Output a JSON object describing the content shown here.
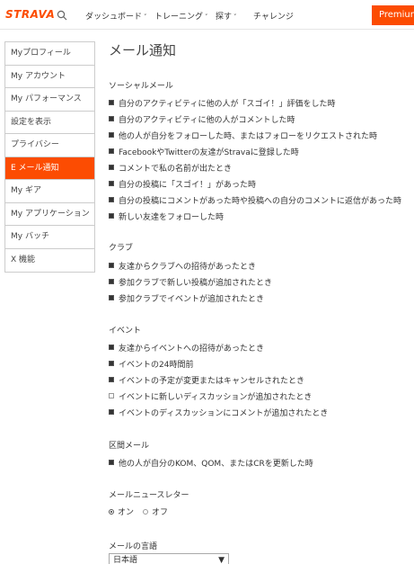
{
  "header": {
    "logo": "STRAVA",
    "nav": [
      {
        "label": "ダッシュボード",
        "chevron": "˅"
      },
      {
        "label": "トレーニング",
        "chevron": "˅"
      },
      {
        "label": "探す",
        "chevron": "˅"
      },
      {
        "label": "チャレンジ",
        "chevron": ""
      }
    ],
    "premium_label": "Premium"
  },
  "sidebar": {
    "items": [
      {
        "label": "Myプロフィール",
        "active": false
      },
      {
        "label": "My アカウント",
        "active": false
      },
      {
        "label": "My パフォーマンス",
        "active": false
      },
      {
        "label": "設定を表示",
        "active": false
      },
      {
        "label": "プライバシー",
        "active": false
      },
      {
        "label": "E メール通知",
        "active": true
      },
      {
        "label": "My ギア",
        "active": false
      },
      {
        "label": "My アプリケーション",
        "active": false
      },
      {
        "label": "My バッチ",
        "active": false
      },
      {
        "label": "X 機能",
        "active": false
      }
    ]
  },
  "main": {
    "title": "メール通知",
    "social": {
      "title": "ソーシャルメール",
      "items": [
        {
          "label": "自分のアクティビティに他の人が「スゴイ！」評価をした時",
          "checked": true
        },
        {
          "label": "自分のアクティビティに他の人がコメントした時",
          "checked": true
        },
        {
          "label": "他の人が自分をフォローした時、またはフォローをリクエストされた時",
          "checked": true
        },
        {
          "label": "FacebookやTwitterの友達がStravaに登録した時",
          "checked": true
        },
        {
          "label": "コメントで私の名前が出たとき",
          "checked": true
        },
        {
          "label": "自分の投稿に「スゴイ！」があった時",
          "checked": true
        },
        {
          "label": "自分の投稿にコメントがあった時や投稿への自分のコメントに返信があった時",
          "checked": true
        },
        {
          "label": "新しい友達をフォローした時",
          "checked": true
        }
      ]
    },
    "club": {
      "title": "クラブ",
      "items": [
        {
          "label": "友達からクラブへの招待があったとき",
          "checked": true
        },
        {
          "label": "参加クラブで新しい投稿が追加されたとき",
          "checked": true
        },
        {
          "label": "参加クラブでイベントが追加されたとき",
          "checked": true
        }
      ]
    },
    "event": {
      "title": "イベント",
      "items": [
        {
          "label": "友達からイベントへの招待があったとき",
          "checked": true
        },
        {
          "label": "イベントの24時間前",
          "checked": true
        },
        {
          "label": "イベントの予定が変更またはキャンセルされたとき",
          "checked": true
        },
        {
          "label": "イベントに新しいディスカッションが追加されたとき",
          "checked": false
        },
        {
          "label": "イベントのディスカッションにコメントが追加されたとき",
          "checked": true
        }
      ]
    },
    "segment": {
      "title": "区間メール",
      "items": [
        {
          "label": "他の人が自分のKOM、QOM、またはCRを更新した時",
          "checked": true
        }
      ]
    },
    "newsletter": {
      "title": "メールニュースレター",
      "on_label": "オン",
      "off_label": "オフ",
      "selected": "on"
    },
    "language": {
      "title": "メールの言語",
      "selected": "日本語",
      "arrow": "▼"
    }
  }
}
